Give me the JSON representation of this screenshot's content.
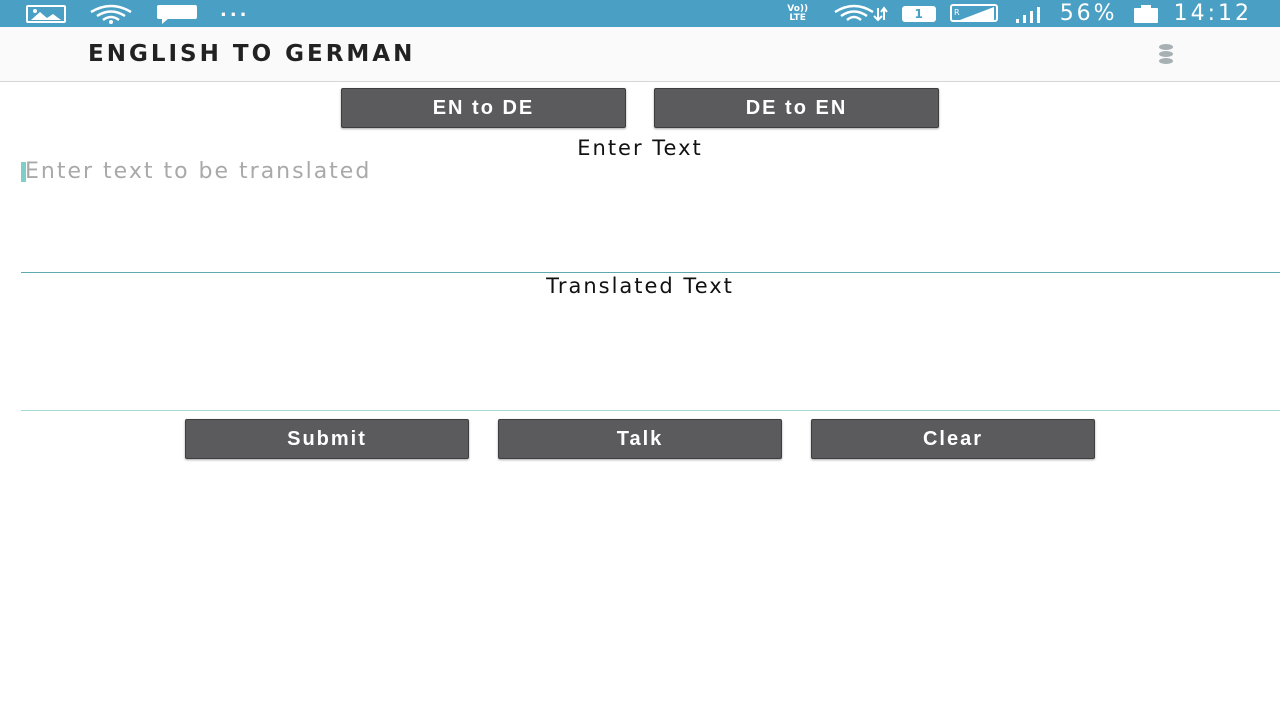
{
  "status_bar": {
    "dots": "...",
    "volte_line1": "Vo))",
    "volte_line2": "LTE",
    "sim_badge": "1",
    "battery_percent": "56%",
    "time": "14:12",
    "icons": [
      "gallery-icon",
      "wifi-icon",
      "message-icon",
      "volte-icon",
      "wifi-data-icon",
      "sim-badge-icon",
      "roaming-signal-icon",
      "signal-icon",
      "battery-icon"
    ]
  },
  "app_bar": {
    "title": "ENGLISH TO GERMAN",
    "menu_icon": "more-vert-icon"
  },
  "direction_buttons": {
    "en_to_de": "EN to DE",
    "de_to_en": "DE to EN"
  },
  "input": {
    "label": "Enter Text",
    "placeholder": "Enter text to be translated",
    "value": ""
  },
  "output": {
    "label": "Translated Text",
    "value": ""
  },
  "actions": {
    "submit": "Submit",
    "talk": "Talk",
    "clear": "Clear"
  },
  "colors": {
    "status_bar": "#4a9fc4",
    "button": "#5b5b5d",
    "input_underline": "#5ea9b0",
    "cursor": "#7ecfc9"
  }
}
